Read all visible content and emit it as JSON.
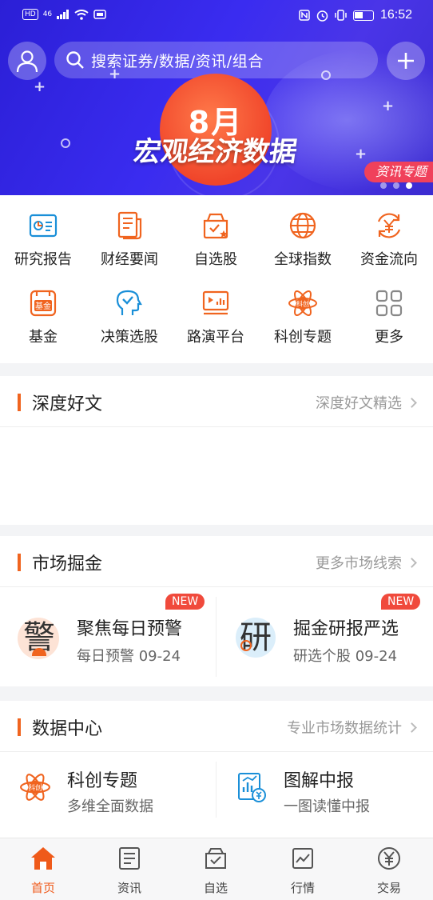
{
  "status_bar": {
    "left_chips": [
      "HD",
      "46"
    ],
    "time": "16:52"
  },
  "header": {
    "search_placeholder": "搜索证券/数据/资讯/组合"
  },
  "banner": {
    "month": "8月",
    "title": "宏观经济数据",
    "tag": "资讯专题",
    "page_count": 3,
    "active_page": 3
  },
  "grid": [
    {
      "label": "研究报告",
      "icon": "report-icon"
    },
    {
      "label": "财经要闻",
      "icon": "news-icon"
    },
    {
      "label": "自选股",
      "icon": "watchlist-icon"
    },
    {
      "label": "全球指数",
      "icon": "globe-icon"
    },
    {
      "label": "资金流向",
      "icon": "money-flow-icon"
    },
    {
      "label": "基金",
      "icon": "fund-icon",
      "icon_text": "基金"
    },
    {
      "label": "决策选股",
      "icon": "decision-icon"
    },
    {
      "label": "路演平台",
      "icon": "roadshow-icon"
    },
    {
      "label": "科创专题",
      "icon": "star-market-icon",
      "icon_text": "科创"
    },
    {
      "label": "更多",
      "icon": "more-grid-icon"
    }
  ],
  "deep": {
    "title": "深度好文",
    "more": "深度好文精选"
  },
  "market": {
    "title": "市场掘金",
    "more": "更多市场线索",
    "cards": [
      {
        "title": "聚焦每日预警",
        "sub": "每日预警 09-24",
        "badge": "NEW",
        "glyph": "警"
      },
      {
        "title": "掘金研报严选",
        "sub": "研选个股 09-24",
        "badge": "NEW",
        "glyph": "研"
      }
    ]
  },
  "data_center": {
    "title": "数据中心",
    "more": "专业市场数据统计",
    "cards": [
      {
        "title": "科创专题",
        "sub": "多维全面数据",
        "icon_text": "科创"
      },
      {
        "title": "图解中报",
        "sub": "一图读懂中报"
      }
    ]
  },
  "tabs": [
    {
      "label": "首页",
      "icon": "home-icon",
      "active": true
    },
    {
      "label": "资讯",
      "icon": "document-icon",
      "active": false
    },
    {
      "label": "自选",
      "icon": "checkbox-icon",
      "active": false
    },
    {
      "label": "行情",
      "icon": "chart-icon",
      "active": false
    },
    {
      "label": "交易",
      "icon": "yen-icon",
      "active": false
    }
  ],
  "colors": {
    "accent": "#ef5a1a",
    "banner": "#3a2cf0",
    "badge": "#f04a3c",
    "icon_blue": "#1a8fd8"
  }
}
